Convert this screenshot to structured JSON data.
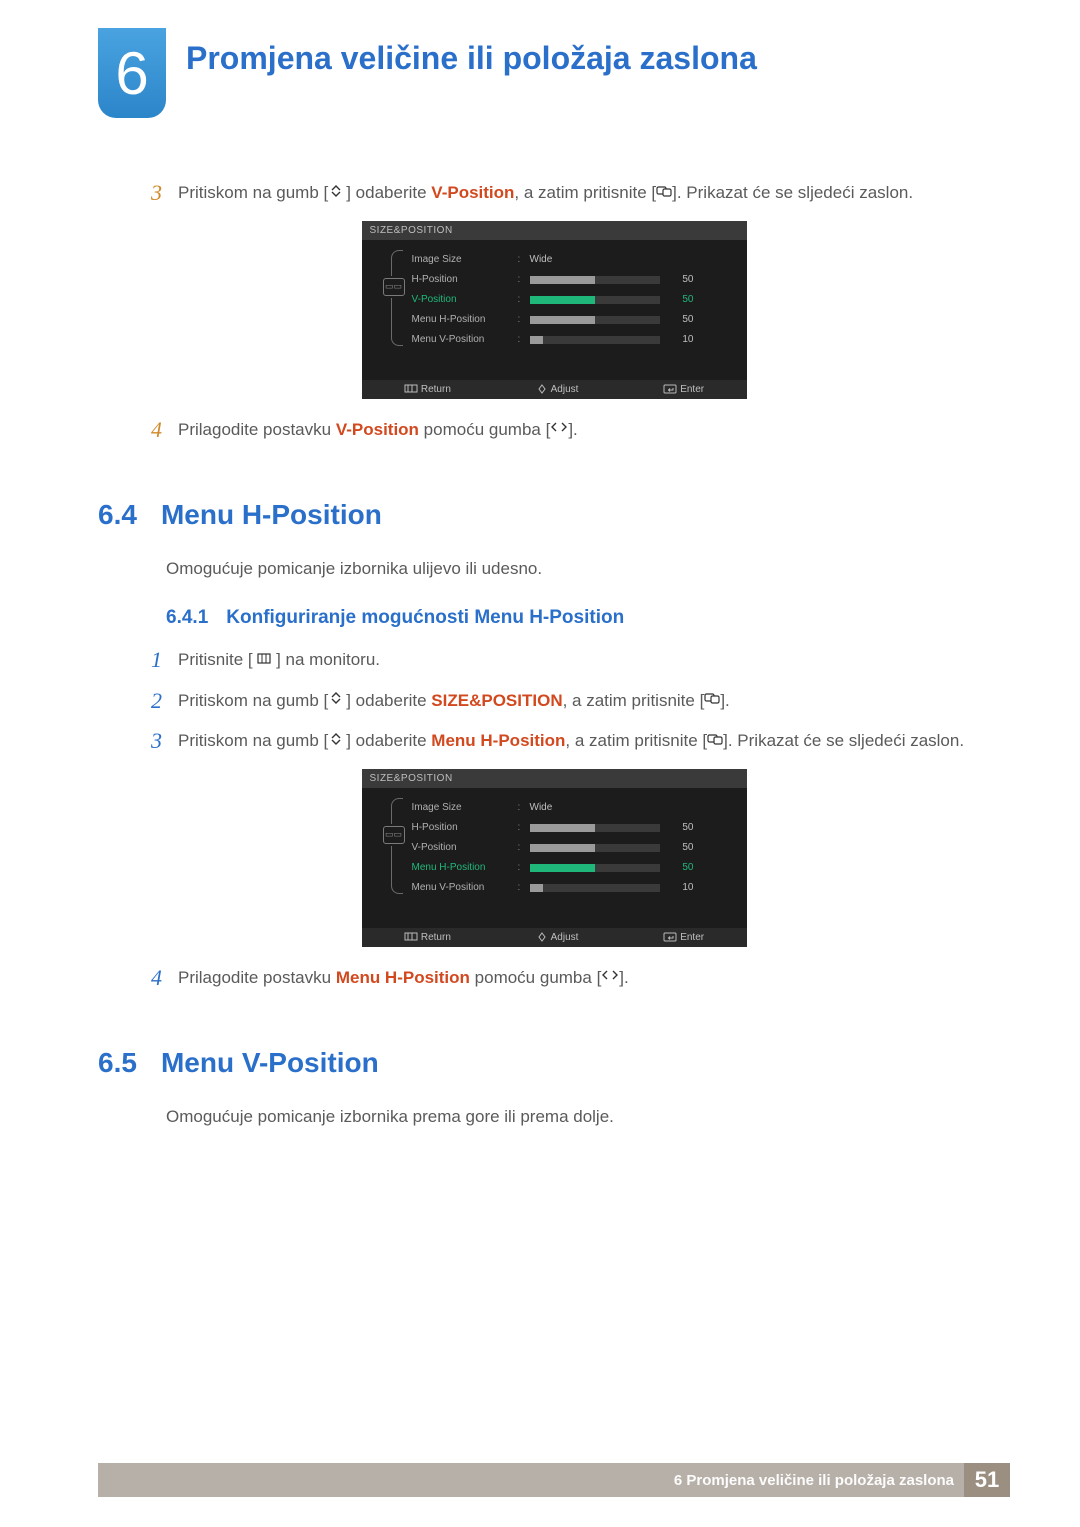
{
  "chapter": {
    "number": "6",
    "title": "Promjena veličine ili položaja zaslona"
  },
  "step3_top": {
    "num": "3",
    "t1": "Pritiskom na gumb [",
    "t2": "] odaberite ",
    "hi": "V-Position",
    "t3": ", a zatim pritisnite [",
    "t4": "]. Prikazat će se sljedeći zaslon."
  },
  "step4_top": {
    "num": "4",
    "t1": "Prilagodite postavku ",
    "hi": "V-Position",
    "t2": " pomoću gumba [",
    "t3": "]."
  },
  "osd1": {
    "title": "SIZE&POSITION",
    "rows": [
      {
        "label": "Image Size",
        "value": "Wide"
      },
      {
        "label": "H-Position",
        "bar": 50,
        "num": "50"
      },
      {
        "label": "V-Position",
        "bar": 50,
        "num": "50",
        "selected": true
      },
      {
        "label": "Menu H-Position",
        "bar": 50,
        "num": "50"
      },
      {
        "label": "Menu V-Position",
        "bar": 10,
        "num": "10"
      }
    ],
    "foot": {
      "return": "Return",
      "adjust": "Adjust",
      "enter": "Enter"
    }
  },
  "section64": {
    "num": "6.4",
    "title": "Menu H-Position"
  },
  "para64": "Omogućuje pomicanje izbornika ulijevo ili udesno.",
  "sub641": {
    "num": "6.4.1",
    "title": "Konfiguriranje mogućnosti Menu H-Position"
  },
  "s641_step1": {
    "num": "1",
    "t1": "Pritisnite [ ",
    "t2": " ] na monitoru."
  },
  "s641_step2": {
    "num": "2",
    "t1": "Pritiskom na gumb [",
    "t2": "] odaberite ",
    "hi": "SIZE&POSITION",
    "t3": ", a zatim pritisnite [",
    "t4": "]."
  },
  "s641_step3": {
    "num": "3",
    "t1": "Pritiskom na gumb [",
    "t2": "] odaberite ",
    "hi": "Menu H-Position",
    "t3": ", a zatim pritisnite [",
    "t4": "]. Prikazat će se sljedeći zaslon."
  },
  "osd2": {
    "title": "SIZE&POSITION",
    "rows": [
      {
        "label": "Image Size",
        "value": "Wide"
      },
      {
        "label": "H-Position",
        "bar": 50,
        "num": "50"
      },
      {
        "label": "V-Position",
        "bar": 50,
        "num": "50"
      },
      {
        "label": "Menu H-Position",
        "bar": 50,
        "num": "50",
        "selected": true
      },
      {
        "label": "Menu V-Position",
        "bar": 10,
        "num": "10"
      }
    ],
    "foot": {
      "return": "Return",
      "adjust": "Adjust",
      "enter": "Enter"
    }
  },
  "s641_step4": {
    "num": "4",
    "t1": "Prilagodite postavku ",
    "hi": "Menu H-Position",
    "t2": " pomoću gumba [",
    "t3": "]."
  },
  "section65": {
    "num": "6.5",
    "title": "Menu V-Position"
  },
  "para65": "Omogućuje pomicanje izbornika prema gore ili prema dolje.",
  "footer": {
    "text": "6 Promjena veličine ili položaja zaslona",
    "page": "51"
  }
}
